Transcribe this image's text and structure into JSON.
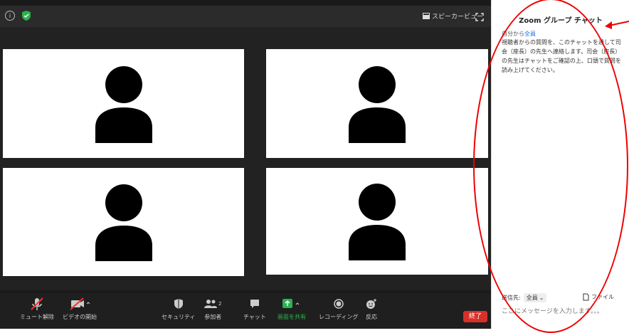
{
  "topbar": {
    "speaker_view_label": "スピーカービュー"
  },
  "toolbar": {
    "mute_label": "ミュート解除",
    "video_label": "ビデオの開始",
    "security_label": "セキュリティ",
    "participants_label": "参加者",
    "participants_count": "2",
    "chat_label": "チャット",
    "share_label": "画面を共有",
    "record_label": "レコーディング",
    "reactions_label": "反応",
    "end_label": "終了"
  },
  "chat": {
    "title": "Zoom グループ チャット",
    "from_prefix": "自分から",
    "from_to": "全員",
    "message": "視聴者からの質問を、このチャットを通して司会（座長）の先生へ連絡します。司会（座長）の先生はチャットをご確認の上、口頭で質問を読み上げてください。",
    "send_to_label": "送信先:",
    "recipient": "全員",
    "file_label": "ファイル",
    "input_placeholder": "ここにメッセージを入力します。。。"
  },
  "colors": {
    "annotation_red": "#e00000",
    "share_green": "#2bb24c",
    "end_red": "#d7302a"
  }
}
